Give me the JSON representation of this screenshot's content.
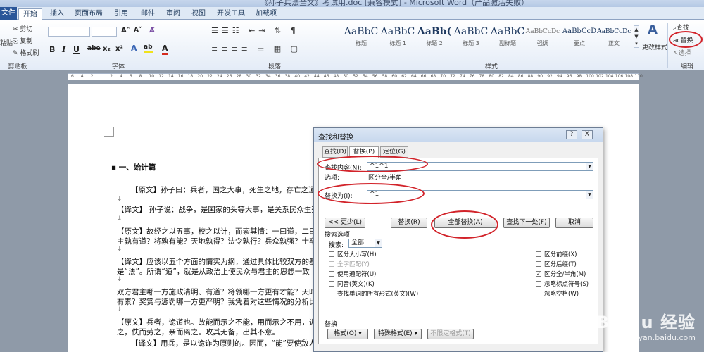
{
  "window_title": "《孙子兵法全文》考试用.doc [兼容模式] - Microsoft Word（产品激活失败）",
  "tabs": [
    "文件",
    "开始",
    "插入",
    "页面布局",
    "引用",
    "邮件",
    "审阅",
    "视图",
    "开发工具",
    "加载项"
  ],
  "clipboard": {
    "paste": "粘贴",
    "cut": "剪切",
    "copy": "复制",
    "format_painter": "格式刷",
    "label": "剪贴板"
  },
  "font": {
    "label": "字体",
    "grow": "A˄",
    "shrink": "A˅",
    "clear": "A̸",
    "bold": "B",
    "italic": "I",
    "underline": "U",
    "strike": "abe",
    "sub": "x₂",
    "sup": "x²"
  },
  "paragraph": {
    "label": "段落"
  },
  "styles": {
    "label": "样式",
    "items": [
      {
        "preview": "AaBbC",
        "name": "标题"
      },
      {
        "preview": "AaBbC",
        "name": "标题 1"
      },
      {
        "preview": "AaBb(",
        "name": "标题 2"
      },
      {
        "preview": "AaBbC",
        "name": "标题 3"
      },
      {
        "preview": "AaBbC",
        "name": "副标题"
      },
      {
        "preview": "AaBbCcDc",
        "name": "强调"
      },
      {
        "preview": "AaBbCcD",
        "name": "要点"
      },
      {
        "preview": "AaBbCcDc",
        "name": "正文"
      }
    ],
    "change_styles": "更改样式"
  },
  "editing": {
    "find": "查找",
    "replace": "替换",
    "select": "选择",
    "label": "编辑"
  },
  "ruler": {
    "ticks": [
      "6",
      "4",
      "2",
      "",
      "2",
      "4",
      "6",
      "8",
      "10",
      "12",
      "14",
      "16",
      "18",
      "20",
      "22",
      "24",
      "26",
      "28",
      "30",
      "32",
      "34",
      "36",
      "38",
      "40",
      "42",
      "44",
      "46",
      "48",
      "50",
      "52",
      "54",
      "56",
      "58",
      "60",
      "62",
      "64",
      "66",
      "68",
      "70",
      "72",
      "74",
      "76",
      "78",
      "80",
      "82",
      "84",
      "86",
      "88",
      "90",
      "92",
      "94",
      "96",
      "98",
      "100",
      "102",
      "104",
      "106",
      "108",
      "110"
    ]
  },
  "document": {
    "heading": "一、始计篇",
    "lines": [
      "【原文】孙子曰：兵者，国之大事，死生之地，存亡之道，",
      "【译文】 孙子说：战争，是国家的头等大事，是关系民众生死",
      "【原文】故经之以五事，校之以计，而索其情：一曰道，二曰天",
      "主孰有道？将孰有能？天地孰得？法令孰行？兵众孰强？士卒孰",
      "【译文】应该以五个方面的情实为纲，通过具体比较双方的基本",
      "是“法”。所谓“道”，就是从政治上使民众与君主的思想一致",
      "双方君主哪一方施政清明、有道？将领哪一方更有才能？天时、",
      "有素？奖赏与惩罚哪一方更严明？我凭着对这些情况的分析比较",
      "【原文】兵者，诡道也。故能而示之不能，用而示之不用，近而",
      "之，佚而劳之，亲而离之。攻其无备，出其不意。",
      "【译文】用兵，是以诡诈为原则的。因而，“能”要使敌人"
    ]
  },
  "dialog": {
    "title": "查找和替换",
    "help": "?",
    "close": "X",
    "tabs": [
      "查找(D)",
      "替换(P)",
      "定位(G)"
    ],
    "find_label": "查找内容(N):",
    "find_value": "^1^1",
    "options_label": "选项:",
    "options_value": "区分全/半角",
    "replace_label": "替换为(I):",
    "replace_value": "^1",
    "buttons": {
      "less": "<< 更少(L)",
      "replace": "替换(R)",
      "replace_all": "全部替换(A)",
      "find_next": "查找下一处(F)",
      "cancel": "取消"
    },
    "search_options": "搜索选项",
    "search_label": "搜索:",
    "search_value": "全部",
    "left_checks": [
      {
        "label": "区分大小写(H)",
        "checked": false,
        "disabled": false
      },
      {
        "label": "全字匹配(Y)",
        "checked": false,
        "disabled": true
      },
      {
        "label": "使用通配符(U)",
        "checked": false,
        "disabled": false
      },
      {
        "label": "同音(英文)(K)",
        "checked": false,
        "disabled": false
      },
      {
        "label": "查找单词的所有形式(英文)(W)",
        "checked": false,
        "disabled": false
      }
    ],
    "right_checks": [
      {
        "label": "区分前缀(X)",
        "checked": false
      },
      {
        "label": "区分后缀(T)",
        "checked": false
      },
      {
        "label": "区分全/半角(M)",
        "checked": true
      },
      {
        "label": "忽略标点符号(S)",
        "checked": false
      },
      {
        "label": "忽略空格(W)",
        "checked": false
      }
    ],
    "replace_section": "替换",
    "format_btn": "格式(O) ▾",
    "special_btn": "特殊格式(E) ▾",
    "no_format_btn": "不限定格式(T)"
  },
  "watermark": {
    "brand": "Baidu 经验",
    "url": "jingyan.baidu.com"
  },
  "accent": "#d2232a"
}
